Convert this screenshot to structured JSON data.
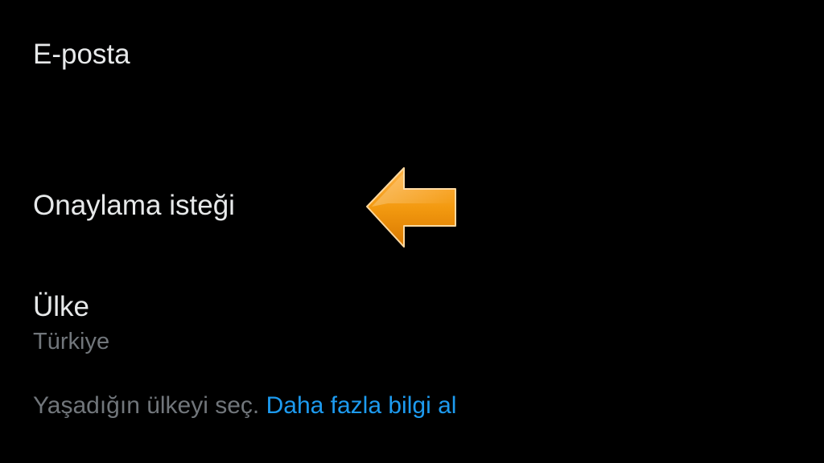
{
  "settings": {
    "email": {
      "label": "E-posta"
    },
    "verification": {
      "label": "Onaylama isteği"
    },
    "country": {
      "label": "Ülke",
      "value": "Türkiye",
      "helper_text": "Yaşadığın ülkeyi seç.",
      "learn_more": "Daha fazla bilgi al"
    }
  },
  "annotation": {
    "icon": "left-arrow-icon",
    "color": "#f39a10"
  },
  "colors": {
    "background": "#000000",
    "primary_text": "#e7e9ea",
    "secondary_text": "#71767b",
    "link": "#1d9bf0"
  }
}
